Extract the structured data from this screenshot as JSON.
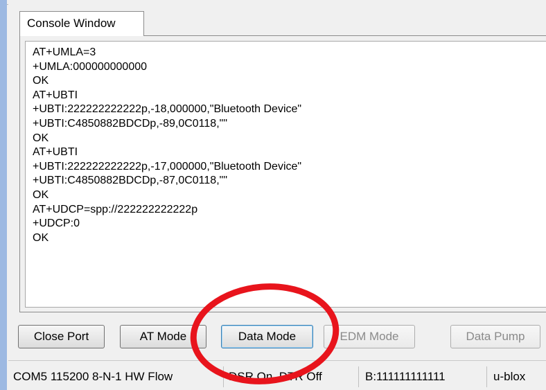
{
  "tab": {
    "label": "Console Window"
  },
  "console": {
    "lines": [
      "AT+UMLA=3",
      "+UMLA:000000000000",
      "OK",
      "AT+UBTI",
      "+UBTI:222222222222p,-18,000000,\"Bluetooth Device\"",
      "+UBTI:C4850882BDCDp,-89,0C0118,\"\"",
      "OK",
      "AT+UBTI",
      "+UBTI:222222222222p,-17,000000,\"Bluetooth Device\"",
      "+UBTI:C4850882BDCDp,-87,0C0118,\"\"",
      "OK",
      "AT+UDCP=spp://222222222222p",
      "+UDCP:0",
      "OK"
    ]
  },
  "buttons": {
    "close_port": "Close Port",
    "at_mode": "AT Mode",
    "data_mode": "Data Mode",
    "edm_mode": "EDM Mode",
    "data_pump": "Data Pump"
  },
  "statusbar": {
    "port_settings": "COM5 115200 8-N-1 HW Flow",
    "dsr_dtr": "DSR On, DTR Off",
    "bt_address": "B:111111111111",
    "vendor": "u-blox"
  },
  "colors": {
    "annotation_circle": "#e8141c",
    "window_edge": "#9db9e2"
  }
}
